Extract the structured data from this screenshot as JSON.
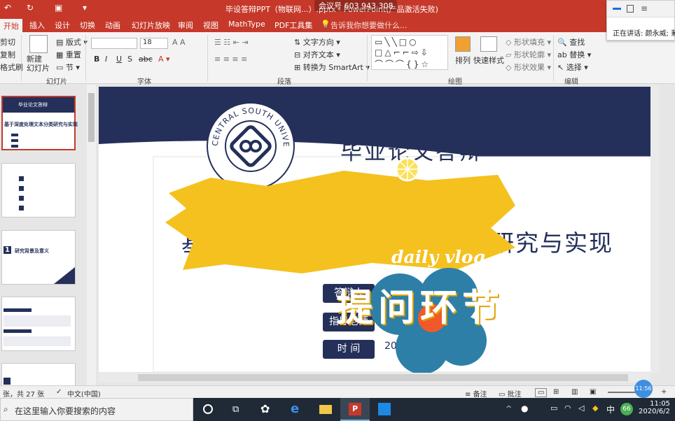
{
  "window": {
    "title": "毕设答辩PPT（物联网...）.pptx - PowerPoint(产品激活失败)",
    "meeting_id": "会议号 603 943 308"
  },
  "tabs": [
    "开始",
    "插入",
    "设计",
    "切换",
    "动画",
    "幻灯片放映",
    "审阅",
    "视图",
    "MathType",
    "PDF工具集"
  ],
  "tell_me": "告诉我你想要做什么...",
  "ribbon": {
    "clipboard": {
      "cut": "剪切",
      "copy": "复制",
      "format_painter": "格式刷"
    },
    "slides": {
      "new_slide": "新建\n幻灯片",
      "layout": "版式",
      "reset": "重置",
      "section": "节",
      "group": "幻灯片"
    },
    "font": {
      "size": "18",
      "group": "字体"
    },
    "paragraph": {
      "text_direction": "文字方向",
      "align_text": "对齐文本",
      "smartart": "转换为 SmartArt",
      "group": "段落"
    },
    "drawing": {
      "arrange": "排列",
      "quick_styles": "快速样式",
      "fill": "形状填充",
      "outline": "形状轮廓",
      "effects": "形状效果",
      "group": "绘图"
    },
    "editing": {
      "find": "查找",
      "replace": "替换",
      "select": "选择",
      "group": "编辑"
    }
  },
  "presenter": {
    "speaking": "正在讲话: 颜永威; 蒹"
  },
  "thumbnails": {
    "t1_title": "毕业论文答辩",
    "t1_sub": "基于深度处理文本分类研究与实现",
    "t3_title": "研究背景及意义"
  },
  "slide": {
    "title": "毕业论文答辩",
    "subtitle": "基于深度学习的文本分类研究与实现",
    "subtitle_visible_left": "基",
    "subtitle_visible_right": "研究与实现",
    "logo_text": "CENTRAL SOUTH UNIVERSITY",
    "pills": [
      "答辩人",
      "指导老师",
      "时 间"
    ],
    "date_partial": "20"
  },
  "overlay": {
    "vlog": "daily vlog",
    "caption": "提问环节"
  },
  "status": {
    "slide_count": "张，共 27 张",
    "language": "中文(中国)",
    "notes": "备注",
    "comments": "批注",
    "zoom_badge": "11:56"
  },
  "taskbar": {
    "search_placeholder": "在这里输入你要搜索的内容",
    "ime": "中",
    "badge": "66",
    "time": "11:05",
    "date": "2020/6/2"
  },
  "colors": {
    "accent": "#c6392a",
    "navy": "#24305a",
    "highlight": "#f4c11f",
    "flower": "#2e7fa8",
    "flower_center": "#f2592a"
  }
}
